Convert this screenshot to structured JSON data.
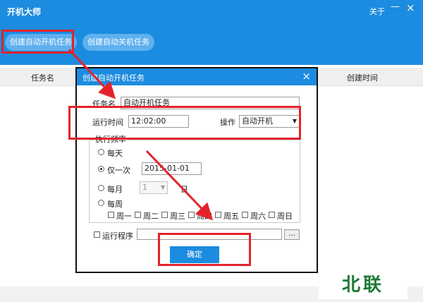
{
  "app": {
    "title": "开机大师",
    "about": "关于",
    "minimize_icon": "—",
    "close_icon": "×",
    "create_on_task": "创建自动开机任务",
    "create_off_task": "创建自动关机任务"
  },
  "table": {
    "columns": [
      "任务名",
      "创建时间"
    ]
  },
  "dialog": {
    "title": "创建自动开机任务",
    "close_icon": "×",
    "task_name_label": "任务名",
    "task_name_value": "自动开机任务",
    "run_time_label": "运行时间",
    "run_time_value": "12:02:00",
    "action_label": "操作",
    "action_value": "自动开机",
    "frequency_label": "执行频率",
    "frequency_options": {
      "daily": "每天",
      "once": "仅一次",
      "monthly": "每月",
      "weekly": "每周"
    },
    "selected_frequency": "once",
    "once_date": "2015-01-01",
    "month_day": "1",
    "month_day_suffix": "日",
    "weekdays": [
      "周一",
      "周二",
      "周三",
      "周四",
      "周五",
      "周六",
      "周日"
    ],
    "run_program_label": "运行程序",
    "browse_label": "...",
    "confirm_label": "确定"
  },
  "watermark": "北联",
  "colors": {
    "header_blue": "#1c8ce0",
    "annotation_red": "#e3232c",
    "watermark_green": "#1f7a38"
  }
}
